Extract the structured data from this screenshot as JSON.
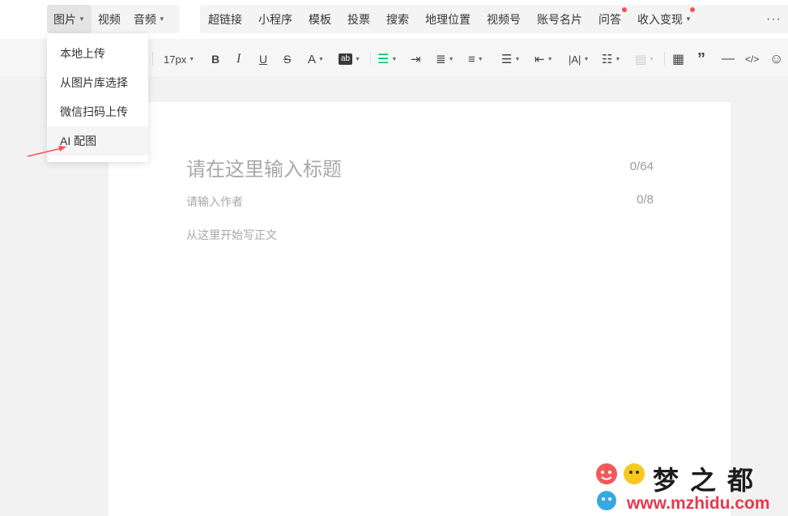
{
  "insert_bar": {
    "image_tab": "图片",
    "video_tab": "视频",
    "audio_tab": "音频",
    "items": [
      "超链接",
      "小程序",
      "模板",
      "投票",
      "搜索",
      "地理位置",
      "视频号",
      "账号名片",
      "问答",
      "收入变现"
    ],
    "more": "···"
  },
  "image_menu": {
    "items": [
      "本地上传",
      "从图片库选择",
      "微信扫码上传",
      "AI 配图"
    ]
  },
  "toolbar": {
    "font_size": "17px",
    "icons": [
      "bold-icon",
      "italic-icon",
      "underline-icon",
      "strikethrough-icon",
      "font-color-icon",
      "highlight-icon",
      "align-icon",
      "indent-icon",
      "paragraph-spacing-icon",
      "line-spacing-icon",
      "letter-spacing-icon",
      "list-icon",
      "table-icon",
      "quote-icon",
      "divider-icon",
      "code-icon",
      "emoji-icon"
    ],
    "accent_color": "#07c160"
  },
  "editor": {
    "title_placeholder": "请在这里输入标题",
    "title_count": "0/64",
    "author_placeholder": "请输入作者",
    "author_count": "0/8",
    "body_placeholder": "从这里开始写正文"
  },
  "watermark": {
    "title": "梦之都",
    "url": "www.mzhidu.com"
  },
  "colors": {
    "notification_dot": "#fa5151",
    "watermark_red": "#e8384f"
  }
}
